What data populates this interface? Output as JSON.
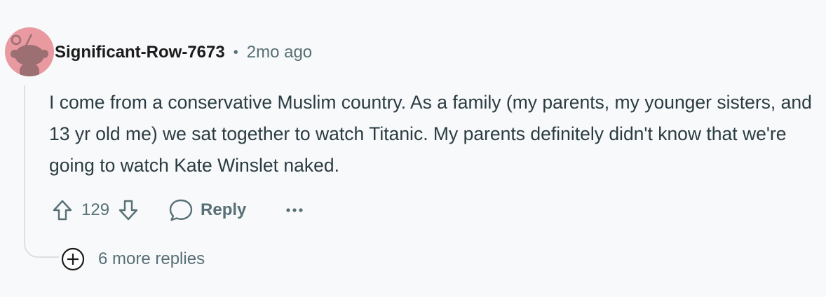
{
  "comment": {
    "author": "Significant-Row-7673",
    "separator": "•",
    "time": "2mo ago",
    "body": "I come from a conservative Muslim country. As a family (my parents, my younger sisters, and 13 yr old me) we sat together to watch Titanic. My parents definitely didn't know that we're going to watch Kate Winslet naked.",
    "score": "129",
    "reply_label": "Reply",
    "more_replies_label": "6 more replies"
  },
  "icons": {
    "avatar": "reddit-snoo-avatar",
    "upvote": "arrow-up-icon",
    "downvote": "arrow-down-icon",
    "reply": "speech-bubble-icon",
    "more": "ellipsis-icon",
    "expand": "plus-circle-icon"
  },
  "colors": {
    "avatar_bg": "#e89aa0",
    "muted_text": "#576f76",
    "body_text": "#2a3c42",
    "thread_line": "#dbe0e3"
  }
}
